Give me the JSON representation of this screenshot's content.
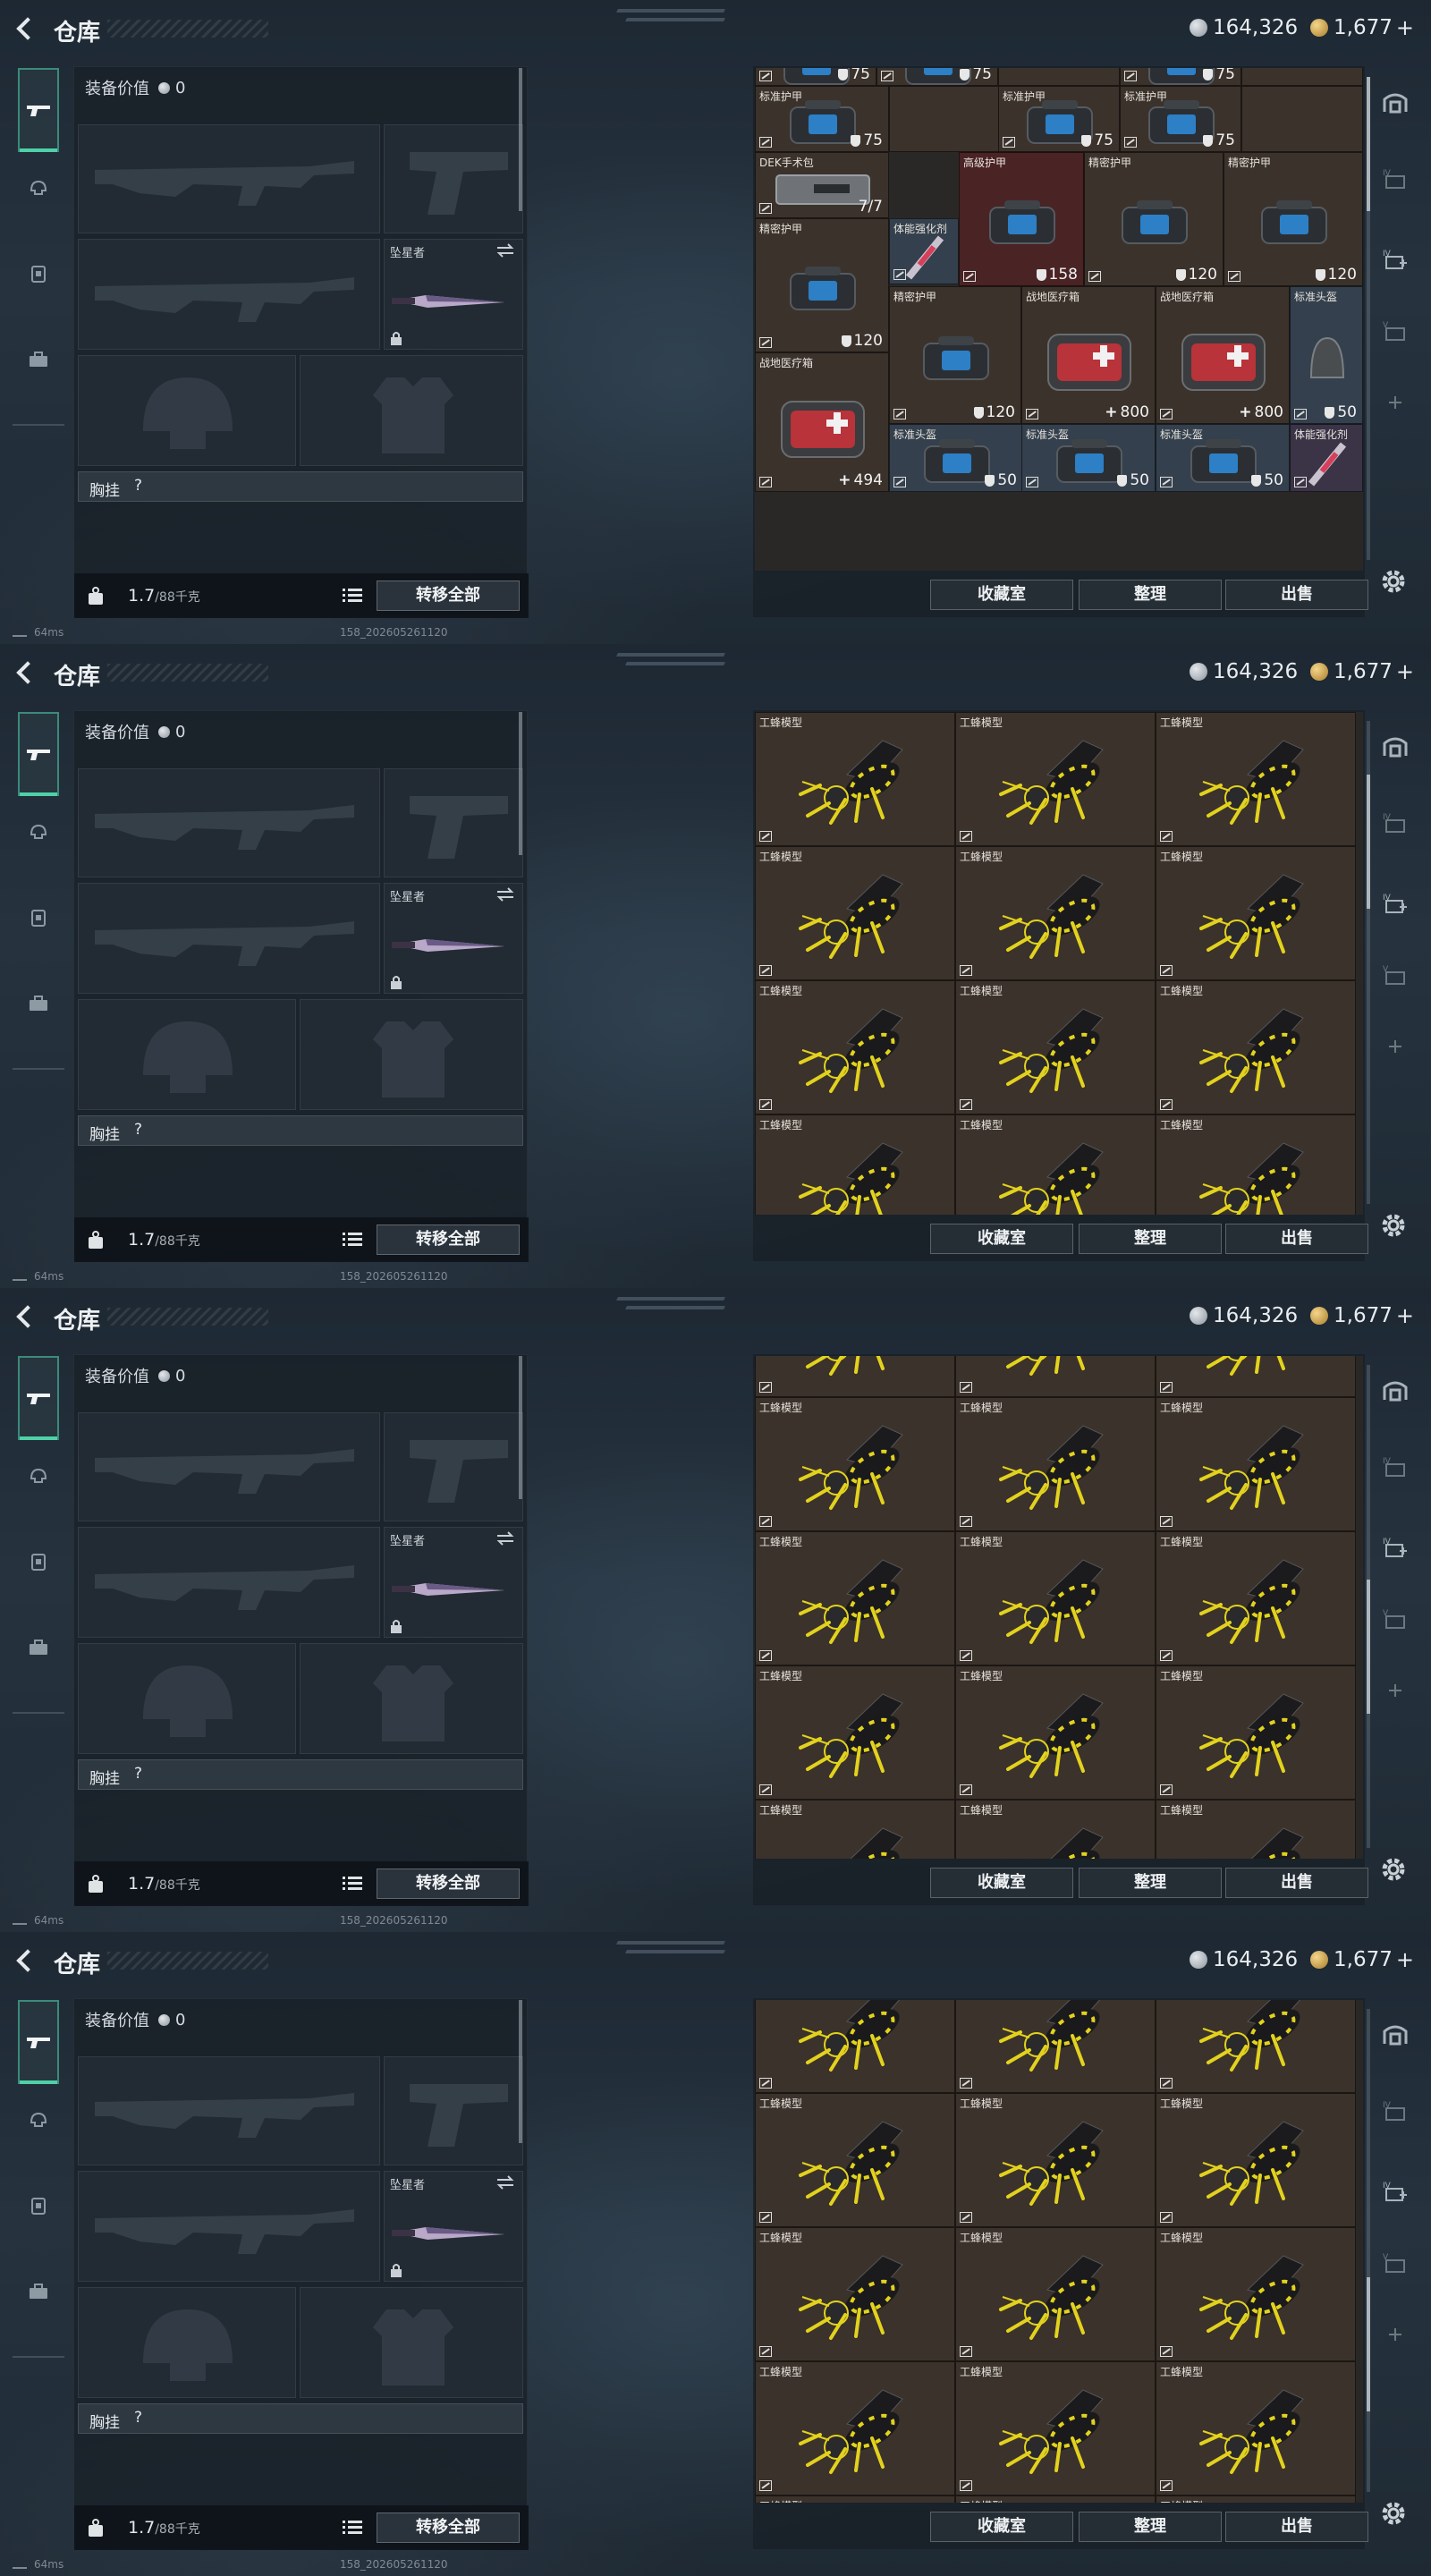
{
  "topbar": {
    "back_label": "",
    "title": "仓库",
    "silver": "164,326",
    "gold": "1,677",
    "gold_plus": "+"
  },
  "loadout": {
    "value_label": "装备价值",
    "value": "0",
    "melee_name": "坠星者",
    "chest_label": "胸挂",
    "chest_q": "?",
    "weight": "1.7",
    "weight_max": "/88千克",
    "transfer_all": "转移全部"
  },
  "status": {
    "ping": "64ms",
    "build": "158_202605261120"
  },
  "stash_actions": {
    "favorites": "收藏室",
    "sort": "整理",
    "sell": "出售"
  },
  "stash_frame1": [
    {
      "name": "",
      "value": "75",
      "kind": "shield",
      "art": "bag"
    },
    {
      "name": "",
      "value": "75",
      "kind": "shield",
      "art": "bag"
    },
    {
      "name": "",
      "value": "75",
      "kind": "shield",
      "art": "bag"
    },
    {
      "name": "标准护甲",
      "value": "75",
      "kind": "shield",
      "art": "bag"
    },
    {
      "name": "标准护甲",
      "value": "75",
      "kind": "shield",
      "art": "bag"
    },
    {
      "name": "标准护甲",
      "value": "75",
      "kind": "shield",
      "art": "bag"
    },
    {
      "name": "DEK手术包",
      "value": "7/7",
      "kind": "text",
      "art": "kit"
    },
    {
      "name": "高级护甲",
      "value": "158",
      "kind": "shield",
      "art": "bag"
    },
    {
      "name": "精密护甲",
      "value": "120",
      "kind": "shield",
      "art": "bag"
    },
    {
      "name": "精密护甲",
      "value": "120",
      "kind": "shield",
      "art": "bag"
    },
    {
      "name": "精密护甲",
      "value": "120",
      "kind": "shield",
      "art": "bag"
    },
    {
      "name": "体能强化剂",
      "value": "",
      "kind": "none",
      "art": "syringe"
    },
    {
      "name": "精密护甲",
      "value": "120",
      "kind": "shield",
      "art": "bag"
    },
    {
      "name": "战地医疗箱",
      "value": "800",
      "kind": "cross",
      "art": "med"
    },
    {
      "name": "战地医疗箱",
      "value": "800",
      "kind": "cross",
      "art": "med"
    },
    {
      "name": "标准头盔",
      "value": "50",
      "kind": "shield",
      "art": "helmet"
    },
    {
      "name": "战地医疗箱",
      "value": "494",
      "kind": "cross",
      "art": "med"
    },
    {
      "name": "标准头盔",
      "value": "50",
      "kind": "shield",
      "art": "bag"
    },
    {
      "name": "标准头盔",
      "value": "50",
      "kind": "shield",
      "art": "bag"
    },
    {
      "name": "标准头盔",
      "value": "50",
      "kind": "shield",
      "art": "bag"
    },
    {
      "name": "体能强化剂",
      "value": "",
      "kind": "none",
      "art": "syringe"
    }
  ],
  "bee_item": {
    "name": "工蜂模型"
  },
  "right_nav": [
    "storage-icon",
    "iv-icon",
    "iv-add-icon",
    "storage-add-icon",
    "v-icon",
    "add-icon",
    "settings-icon"
  ],
  "colors": {
    "accent": "#4fd1a8",
    "bee_yellow": "#e3d21d",
    "cell_bg": "#3b322b",
    "rare_red": "#4a2325"
  }
}
